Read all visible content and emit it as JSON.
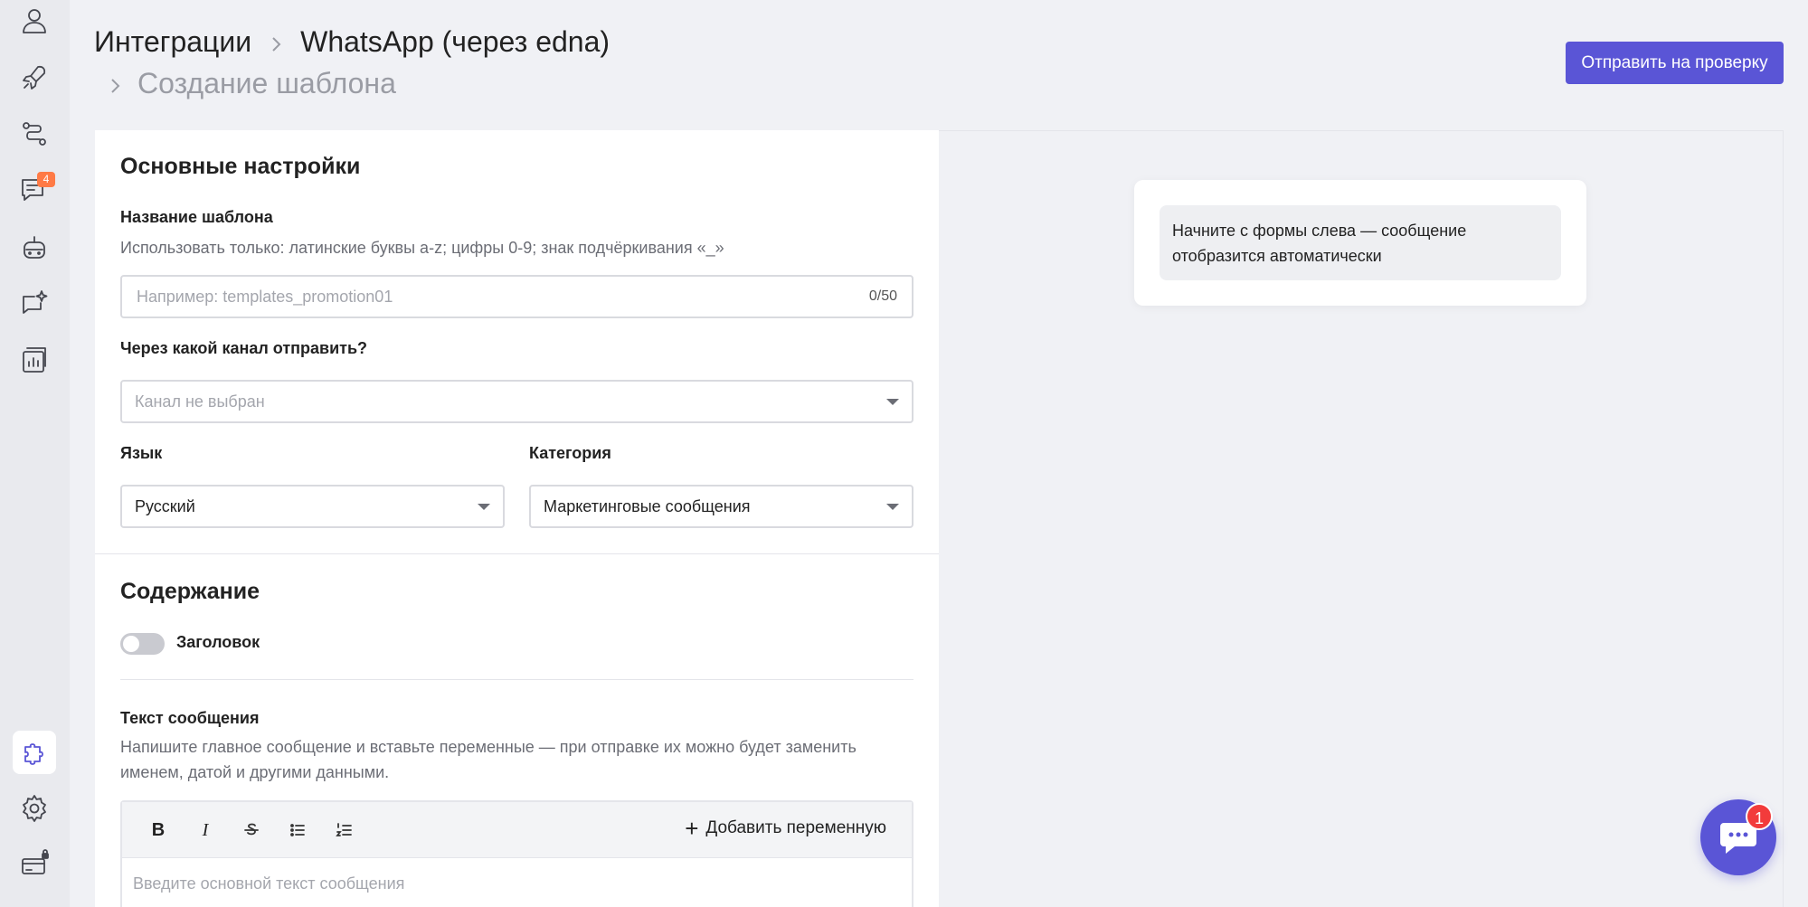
{
  "sidebar": {
    "items": [
      {
        "icon": "users-icon"
      },
      {
        "icon": "rocket-icon"
      },
      {
        "icon": "route-icon"
      },
      {
        "icon": "chat-icon",
        "badge": "4"
      },
      {
        "icon": "bot-icon"
      },
      {
        "icon": "sparkle-chat-icon"
      },
      {
        "icon": "analytics-icon"
      },
      {
        "icon": "puzzle-icon",
        "active": true
      },
      {
        "icon": "gear-icon"
      },
      {
        "icon": "billing-icon"
      }
    ],
    "accent": "#5a55d6",
    "badge_color": "#ff7a45"
  },
  "breadcrumb": {
    "item1": "Интеграции",
    "item2": "WhatsApp (через edna)",
    "current": "Создание шаблона"
  },
  "header": {
    "submit_label": "Отправить на проверку"
  },
  "form": {
    "basic": {
      "title": "Основные настройки",
      "name_label": "Название шаблона",
      "name_hint": "Использовать только: латинские буквы a-z; цифры 0-9; знак подчёркивания «_»",
      "name_placeholder": "Например: templates_promotion01",
      "name_counter": "0/50",
      "channel_label": "Через какой канал отправить?",
      "channel_placeholder": "Канал не выбран",
      "language_label": "Язык",
      "language_value": "Русский",
      "category_label": "Категория",
      "category_value": "Маркетинговые сообщения"
    },
    "content": {
      "title": "Содержание",
      "header_toggle_label": "Заголовок",
      "header_toggle_on": false,
      "message_label": "Текст сообщения",
      "message_hint": "Напишите главное сообщение и вставьте переменные — при отправке их можно будет заменить именем, датой и другими данными.",
      "toolbar": {
        "bold": "B",
        "italic": "I",
        "add_variable": "Добавить переменную"
      },
      "message_placeholder": "Введите основной текст сообщения"
    }
  },
  "preview": {
    "text": "Начните с формы слева — сообщение отобразится автоматически"
  },
  "chat_widget": {
    "badge": "1"
  }
}
